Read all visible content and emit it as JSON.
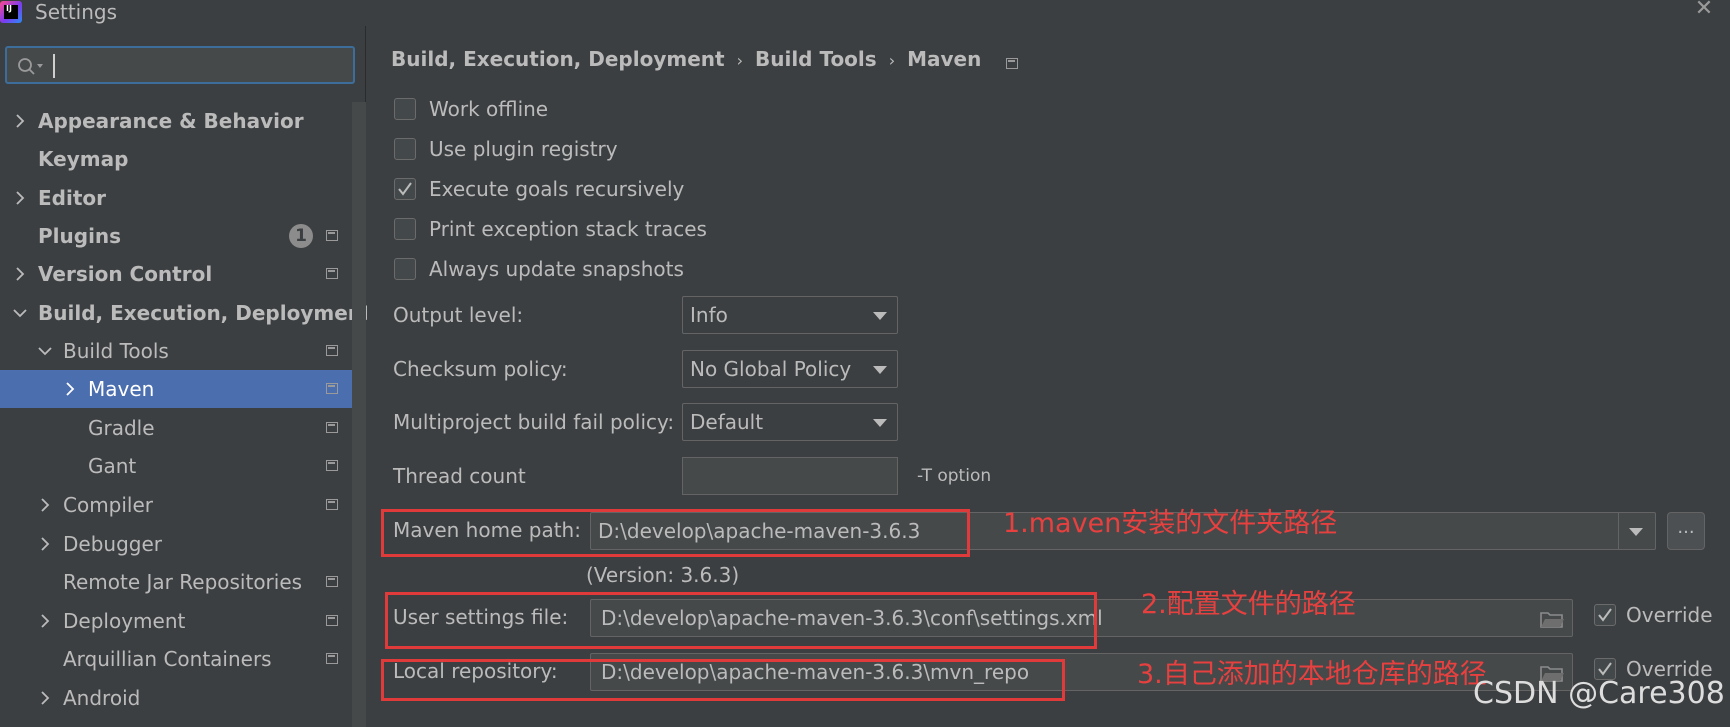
{
  "window": {
    "title": "Settings",
    "logo_text": "IJ",
    "close": "✕"
  },
  "search": {
    "placeholder": ""
  },
  "sidebar": {
    "items": [
      {
        "label": "Appearance & Behavior",
        "chevron": "right"
      },
      {
        "label": "Keymap"
      },
      {
        "label": "Editor",
        "chevron": "right"
      },
      {
        "label": "Plugins",
        "badge": "1"
      },
      {
        "label": "Version Control",
        "chevron": "right"
      },
      {
        "label": "Build, Execution, Deployment",
        "chevron": "down"
      },
      {
        "label": "Build Tools",
        "chevron": "down"
      },
      {
        "label": "Maven",
        "chevron": "right"
      },
      {
        "label": "Gradle"
      },
      {
        "label": "Gant"
      },
      {
        "label": "Compiler",
        "chevron": "right"
      },
      {
        "label": "Debugger",
        "chevron": "right"
      },
      {
        "label": "Remote Jar Repositories"
      },
      {
        "label": "Deployment",
        "chevron": "right"
      },
      {
        "label": "Arquillian Containers"
      },
      {
        "label": "Android",
        "chevron": "right"
      }
    ]
  },
  "breadcrumb": {
    "items": [
      "Build, Execution, Deployment",
      "Build Tools",
      "Maven"
    ],
    "separator": "›"
  },
  "checkboxes": [
    {
      "label": "Work offline",
      "checked": false
    },
    {
      "label": "Use plugin registry",
      "checked": false
    },
    {
      "label": "Execute goals recursively",
      "checked": true
    },
    {
      "label": "Print exception stack traces",
      "checked": false
    },
    {
      "label": "Always update snapshots",
      "checked": false
    }
  ],
  "fields": {
    "output_level": {
      "label": "Output level:",
      "value": "Info"
    },
    "checksum_policy": {
      "label": "Checksum policy:",
      "value": "No Global Policy"
    },
    "fail_policy": {
      "label": "Multiproject build fail policy:",
      "value": "Default"
    },
    "thread_count": {
      "label": "Thread count",
      "value": "",
      "hint": "-T option"
    },
    "maven_home": {
      "label": "Maven home path:",
      "value": "D:\\develop\\apache-maven-3.6.3",
      "version": "(Version: 3.6.3)",
      "browse": "..."
    },
    "user_settings": {
      "label": "User settings file:",
      "value": "D:\\develop\\apache-maven-3.6.3\\conf\\settings.xml",
      "override_label": "Override",
      "override_checked": true
    },
    "local_repo": {
      "label": "Local repository:",
      "value": "D:\\develop\\apache-maven-3.6.3\\mvn_repo",
      "override_label": "Override",
      "override_checked": true
    }
  },
  "annotations": {
    "a1": "1.maven安装的文件夹路径",
    "a2": "2.配置文件的路径",
    "a3": "3.自己添加的本地仓库的路径",
    "watermark": "CSDN @Care308",
    "color": "#e03a3a"
  },
  "colors": {
    "background": "#3c3f41",
    "selection": "#4b6eaf",
    "focus_border": "#3d6e9b"
  }
}
